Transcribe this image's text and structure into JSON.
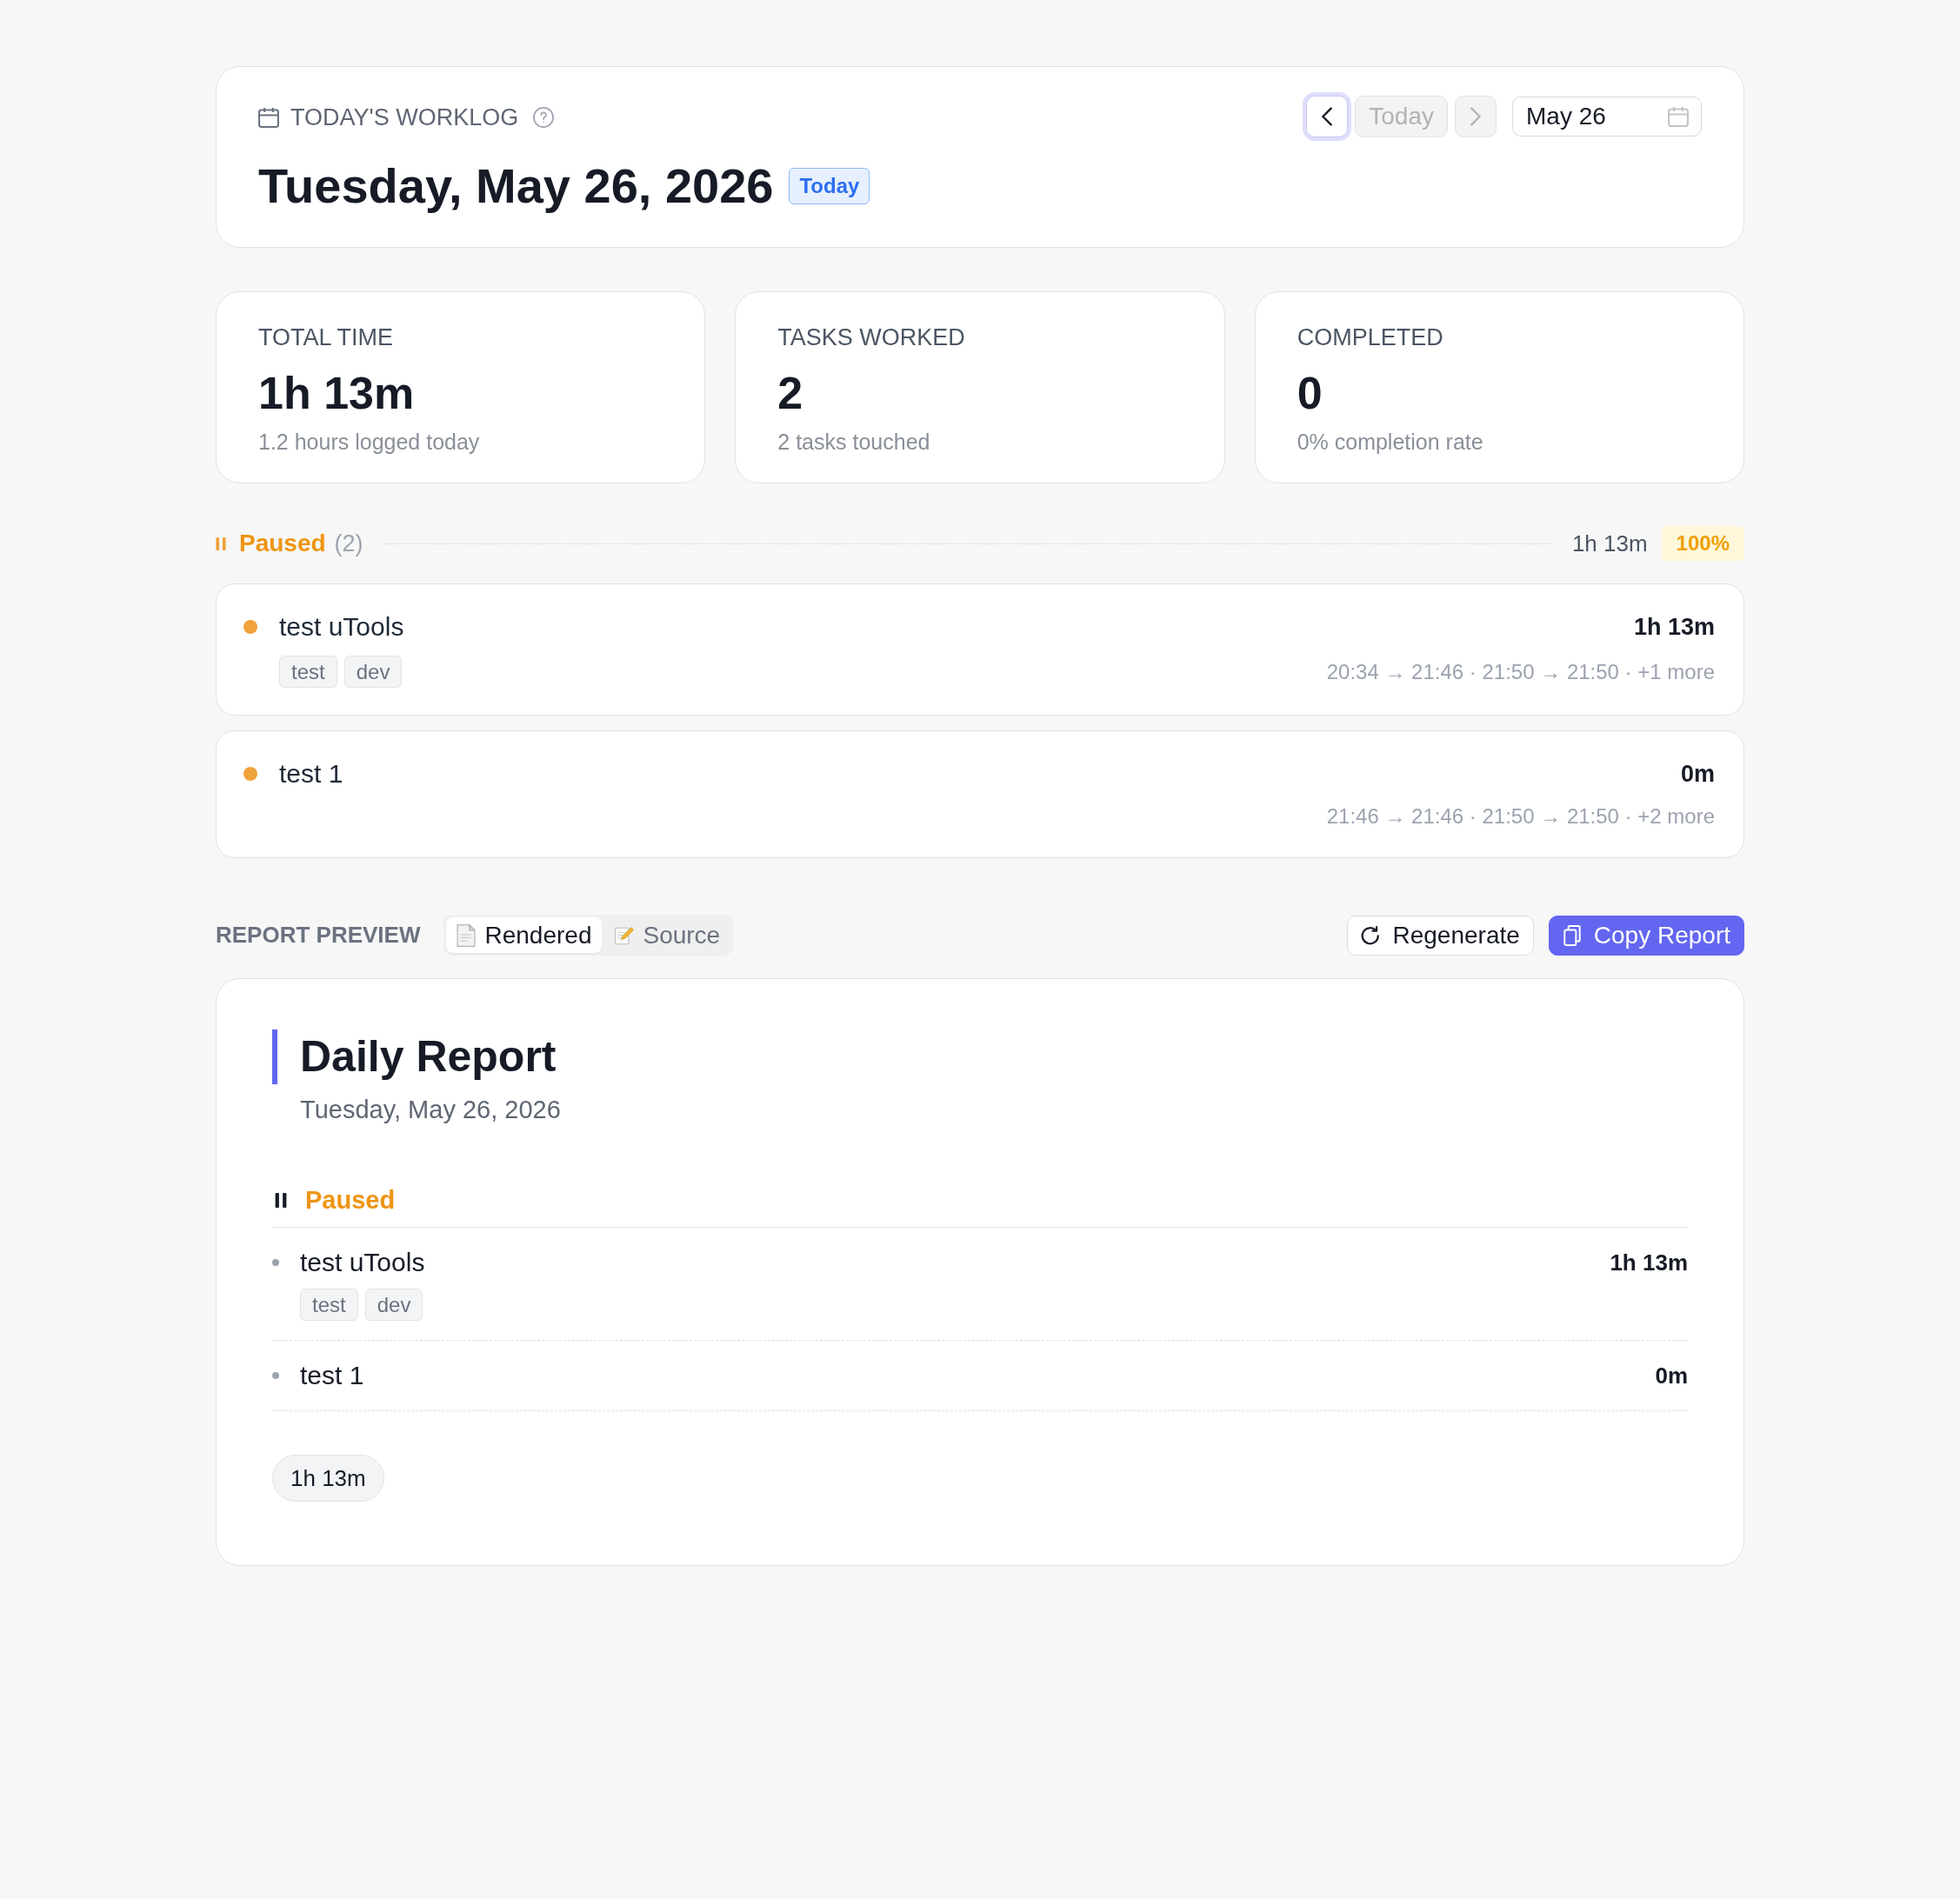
{
  "header": {
    "label": "TODAY'S WORKLOG",
    "title": "Tuesday, May 26, 2026",
    "badge": "Today",
    "nav": [
      {
        "kind": "prev",
        "disabled": false,
        "focused": true
      },
      {
        "kind": "today",
        "label": "Today",
        "disabled": true,
        "focused": false
      },
      {
        "kind": "next",
        "disabled": true,
        "focused": false
      }
    ],
    "date_field": {
      "value": "May 26"
    }
  },
  "stats": [
    {
      "label": "TOTAL TIME",
      "value": "1h 13m",
      "note": "1.2 hours logged today"
    },
    {
      "label": "TASKS WORKED",
      "value": "2",
      "note": "2 tasks touched"
    },
    {
      "label": "COMPLETED",
      "value": "0",
      "note": "0% completion rate"
    }
  ],
  "groups": [
    {
      "kind": "paused",
      "label": "Paused",
      "count": "(2)",
      "total": "1h 13m",
      "share": "100%",
      "tasks": [
        {
          "title": "test uTools",
          "tags": [
            "test",
            "dev"
          ],
          "duration": "1h 13m",
          "sessions": "20:34 → 21:46 · 21:50 → 21:50 · +1 more"
        },
        {
          "title": "test 1",
          "duration": "0m",
          "sessions": "21:46 → 21:46 · 21:50 → 21:50 · +2 more"
        }
      ]
    }
  ],
  "report_preview": {
    "label": "REPORT PREVIEW",
    "view_tabs": [
      {
        "kind": "rendered",
        "label": "Rendered",
        "selected": true
      },
      {
        "kind": "source",
        "label": "Source",
        "selected": false
      }
    ],
    "actions": [
      {
        "kind": "regenerate",
        "label": "Regenerate",
        "primary": false
      },
      {
        "kind": "copy",
        "label": "Copy Report",
        "primary": true
      }
    ]
  },
  "report": {
    "title": "Daily Report",
    "date": "Tuesday, May 26, 2026",
    "sections": [
      {
        "kind": "paused",
        "heading": "Paused",
        "items": [
          {
            "title": "test uTools",
            "tags": [
              "test",
              "dev"
            ],
            "duration": "1h 13m"
          },
          {
            "title": "test 1",
            "duration": "0m"
          }
        ]
      }
    ],
    "total": "1h 13m"
  }
}
